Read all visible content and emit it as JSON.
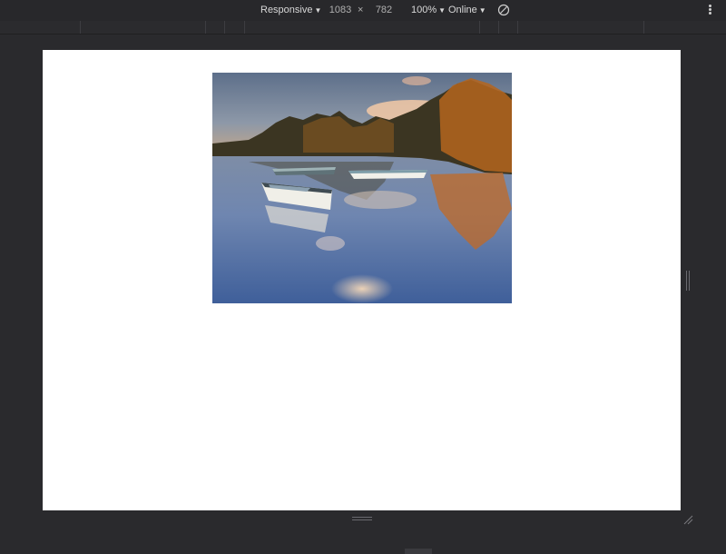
{
  "toolbar": {
    "device": "Responsive",
    "width": "1083",
    "separator": "×",
    "height": "782",
    "zoom": "100%",
    "throttle": "Online",
    "rotate_icon": "rotate-icon",
    "menu_icon": "more-vertical-icon"
  },
  "viewport": {
    "image": {
      "subject": "lake-boats-photo",
      "alt": ""
    }
  },
  "colors": {
    "chrome": "#28282b",
    "page": "#ffffff"
  }
}
